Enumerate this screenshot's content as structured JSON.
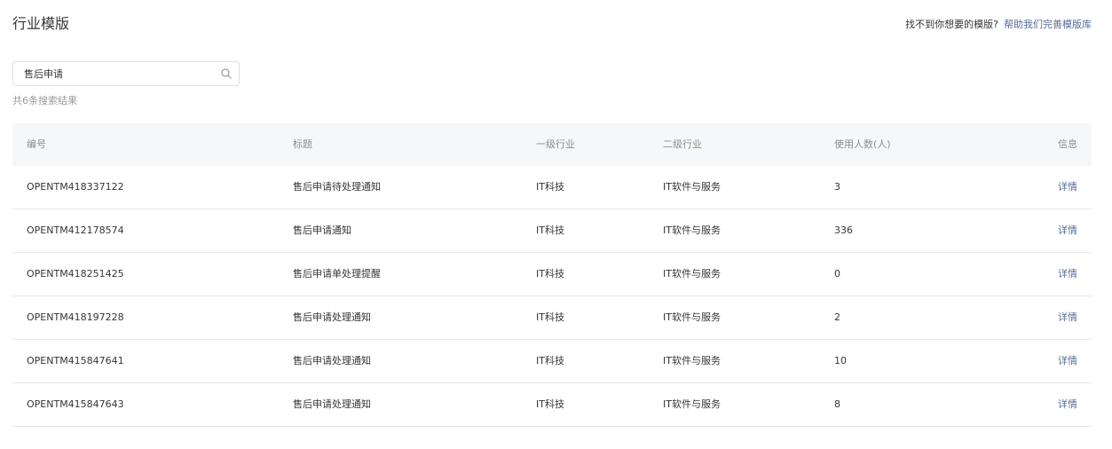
{
  "header": {
    "title": "行业模版",
    "help_prompt": "找不到你想要的模版?",
    "help_link": "帮助我们完善模版库"
  },
  "search": {
    "value": "售后申请",
    "result_count": "共6条搜索结果"
  },
  "table": {
    "columns": [
      "编号",
      "标题",
      "一级行业",
      "二级行业",
      "使用人数(人)",
      "信息"
    ],
    "rows": [
      {
        "id": "OPENTM418337122",
        "title": "售后申请待处理通知",
        "industry1": "IT科技",
        "industry2": "IT软件与服务",
        "users": "3",
        "action": "详情"
      },
      {
        "id": "OPENTM412178574",
        "title": "售后申请通知",
        "industry1": "IT科技",
        "industry2": "IT软件与服务",
        "users": "336",
        "action": "详情"
      },
      {
        "id": "OPENTM418251425",
        "title": "售后申请单处理提醒",
        "industry1": "IT科技",
        "industry2": "IT软件与服务",
        "users": "0",
        "action": "详情"
      },
      {
        "id": "OPENTM418197228",
        "title": "售后申请处理通知",
        "industry1": "IT科技",
        "industry2": "IT软件与服务",
        "users": "2",
        "action": "详情"
      },
      {
        "id": "OPENTM415847641",
        "title": "售后申请处理通知",
        "industry1": "IT科技",
        "industry2": "IT软件与服务",
        "users": "10",
        "action": "详情"
      },
      {
        "id": "OPENTM415847643",
        "title": "售后申请处理通知",
        "industry1": "IT科技",
        "industry2": "IT软件与服务",
        "users": "8",
        "action": "详情"
      }
    ]
  },
  "colors": {
    "link": "#576b95",
    "header_bg": "#f6f7f9",
    "border": "#e7e7eb"
  },
  "icons": {
    "search": "search-icon"
  }
}
